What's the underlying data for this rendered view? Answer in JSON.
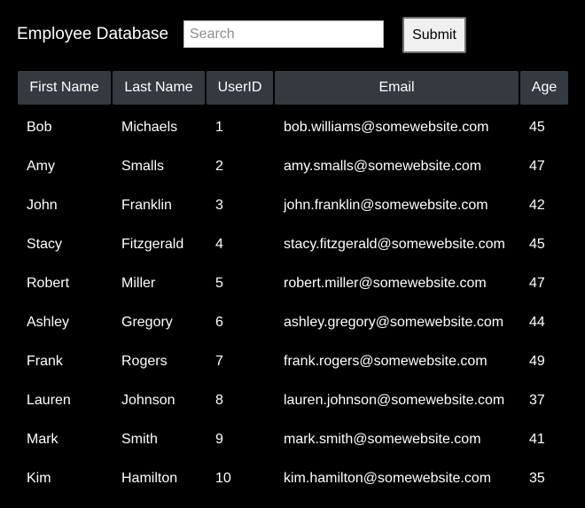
{
  "header": {
    "title": "Employee Database",
    "search_placeholder": "Search",
    "search_value": "",
    "submit_label": "Submit"
  },
  "table": {
    "columns": [
      "First Name",
      "Last Name",
      "UserID",
      "Email",
      "Age"
    ],
    "rows": [
      [
        "Bob",
        "Michaels",
        "1",
        "bob.williams@somewebsite.com",
        "45"
      ],
      [
        "Amy",
        "Smalls",
        "2",
        "amy.smalls@somewebsite.com",
        "47"
      ],
      [
        "John",
        "Franklin",
        "3",
        "john.franklin@somewebsite.com",
        "42"
      ],
      [
        "Stacy",
        "Fitzgerald",
        "4",
        "stacy.fitzgerald@somewebsite.com",
        "45"
      ],
      [
        "Robert",
        "Miller",
        "5",
        "robert.miller@somewebsite.com",
        "47"
      ],
      [
        "Ashley",
        "Gregory",
        "6",
        "ashley.gregory@somewebsite.com",
        "44"
      ],
      [
        "Frank",
        "Rogers",
        "7",
        "frank.rogers@somewebsite.com",
        "49"
      ],
      [
        "Lauren",
        "Johnson",
        "8",
        "lauren.johnson@somewebsite.com",
        "37"
      ],
      [
        "Mark",
        "Smith",
        "9",
        "mark.smith@somewebsite.com",
        "41"
      ],
      [
        "Kim",
        "Hamilton",
        "10",
        "kim.hamilton@somewebsite.com",
        "35"
      ]
    ]
  },
  "colors": {
    "background": "#000000",
    "header_cell": "#343a40",
    "text": "#ffffff"
  }
}
